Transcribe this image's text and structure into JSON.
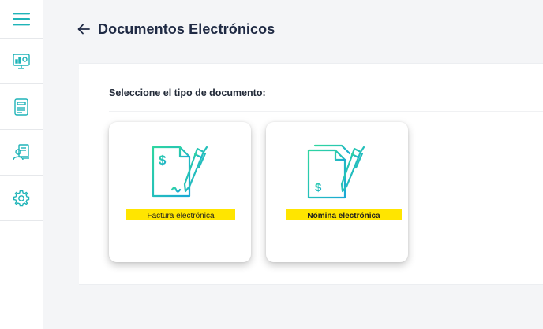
{
  "sidebar": {
    "items": [
      {
        "icon": "hamburger-menu-icon"
      },
      {
        "icon": "monitor-chart-icon"
      },
      {
        "icon": "form-document-icon"
      },
      {
        "icon": "user-documents-icon"
      },
      {
        "icon": "settings-gear-icon"
      }
    ]
  },
  "header": {
    "back_icon": "arrow-left-icon",
    "title": "Documentos Electrónicos"
  },
  "main": {
    "prompt": "Seleccione el tipo de documento:",
    "cards": [
      {
        "label": "Factura electrónica",
        "icon": "invoice-document-icon"
      },
      {
        "label": "Nómina electrónica",
        "icon": "payroll-document-icon"
      }
    ]
  },
  "colors": {
    "accent_teal": "#1fb4b8",
    "icon_gradient_start": "#2fd6a0",
    "icon_gradient_end": "#1aa8d6",
    "label_highlight": "#ffe500",
    "title_text": "#1f2a44"
  }
}
